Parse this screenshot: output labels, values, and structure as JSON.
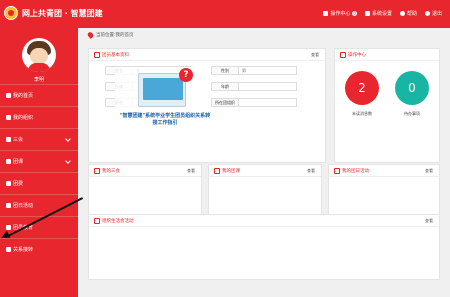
{
  "header": {
    "brand": "网上共青团 · 智慧团建",
    "nav": [
      {
        "label": "操作中心",
        "badge": "0"
      },
      {
        "label": "系统设置"
      },
      {
        "label": "帮助"
      },
      {
        "label": "退出"
      }
    ]
  },
  "sidebar": {
    "username": "李明",
    "items": [
      {
        "label": "我的首页",
        "has_chevron": false
      },
      {
        "label": "我的组织",
        "has_chevron": false
      },
      {
        "label": "三会",
        "has_chevron": true
      },
      {
        "label": "团课",
        "has_chevron": true
      },
      {
        "label": "团费",
        "has_chevron": false
      },
      {
        "label": "团日活动",
        "has_chevron": false
      },
      {
        "label": "团员教育",
        "has_chevron": false
      },
      {
        "label": "关系接转",
        "has_chevron": false
      }
    ]
  },
  "breadcrumb": "当前位置:我的首页",
  "panels": {
    "member_info": {
      "title": "团员基本资料",
      "more": "查看",
      "rows": [
        [
          {
            "label": "姓名",
            "value": "李"
          },
          {
            "label": "性别",
            "value": "男"
          }
        ],
        [
          {
            "label": "民族",
            "value": ""
          },
          {
            "label": "年龄",
            "value": ""
          }
        ],
        [
          {
            "label": "职业",
            "value": ""
          },
          {
            "label": "所在团组织",
            "value": ""
          }
        ]
      ],
      "overlay_text": "\"智慧团建\"系统毕业学生团员组织关系转接工作指引"
    },
    "operation_center": {
      "title": "操作中心",
      "stats": [
        {
          "value": "2",
          "label": "未读消息数",
          "color": "#e8262d"
        },
        {
          "value": "0",
          "label": "待办事项",
          "color": "#19b5a4"
        }
      ]
    },
    "three_meetings": {
      "title": "我的三会",
      "more": "查看"
    },
    "team_class": {
      "title": "我的团课",
      "more": "查看"
    },
    "league_day": {
      "title": "我的团日活动",
      "more": "查看"
    },
    "org_life": {
      "title": "组织生活会活动",
      "more": "查看"
    }
  },
  "colors": {
    "primary": "#e8262d",
    "teal": "#19b5a4"
  }
}
